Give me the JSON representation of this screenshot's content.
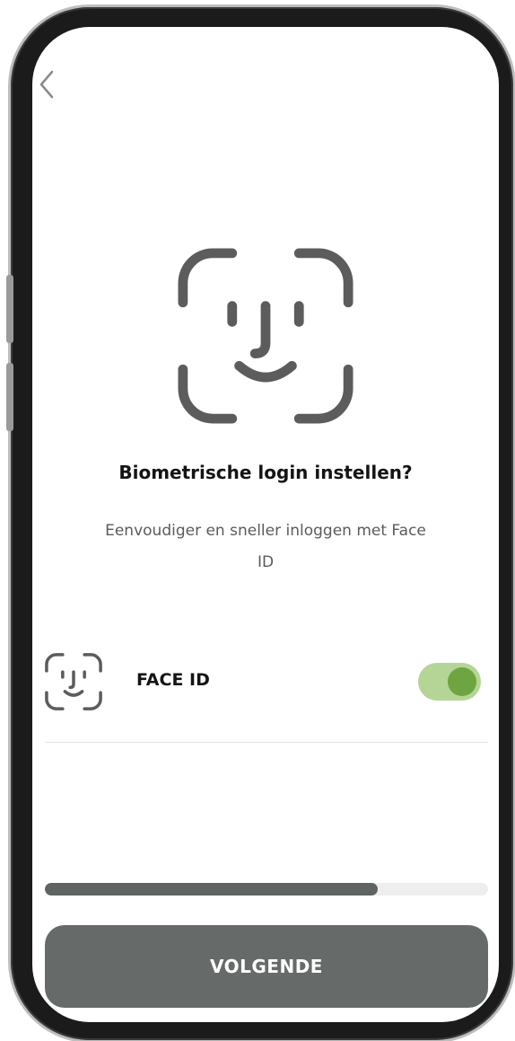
{
  "setup": {
    "title": "Biometrische login instellen?",
    "subtitle": "Eenvoudiger en sneller inloggen met Face ID"
  },
  "face_id_row": {
    "label": "FACE ID",
    "enabled": true,
    "icon": "face-id-icon"
  },
  "progress": {
    "fraction": 0.75
  },
  "footer": {
    "next_label": "VOLGENDE"
  },
  "icons": {
    "back": "chevron-left-icon",
    "hero": "face-id-icon"
  },
  "colors": {
    "icon": "#5c5c5c",
    "toggle_track": "#b4d596",
    "toggle_knob": "#6ea540",
    "button": "#666b6a",
    "progress_fill": "#5f6362"
  }
}
